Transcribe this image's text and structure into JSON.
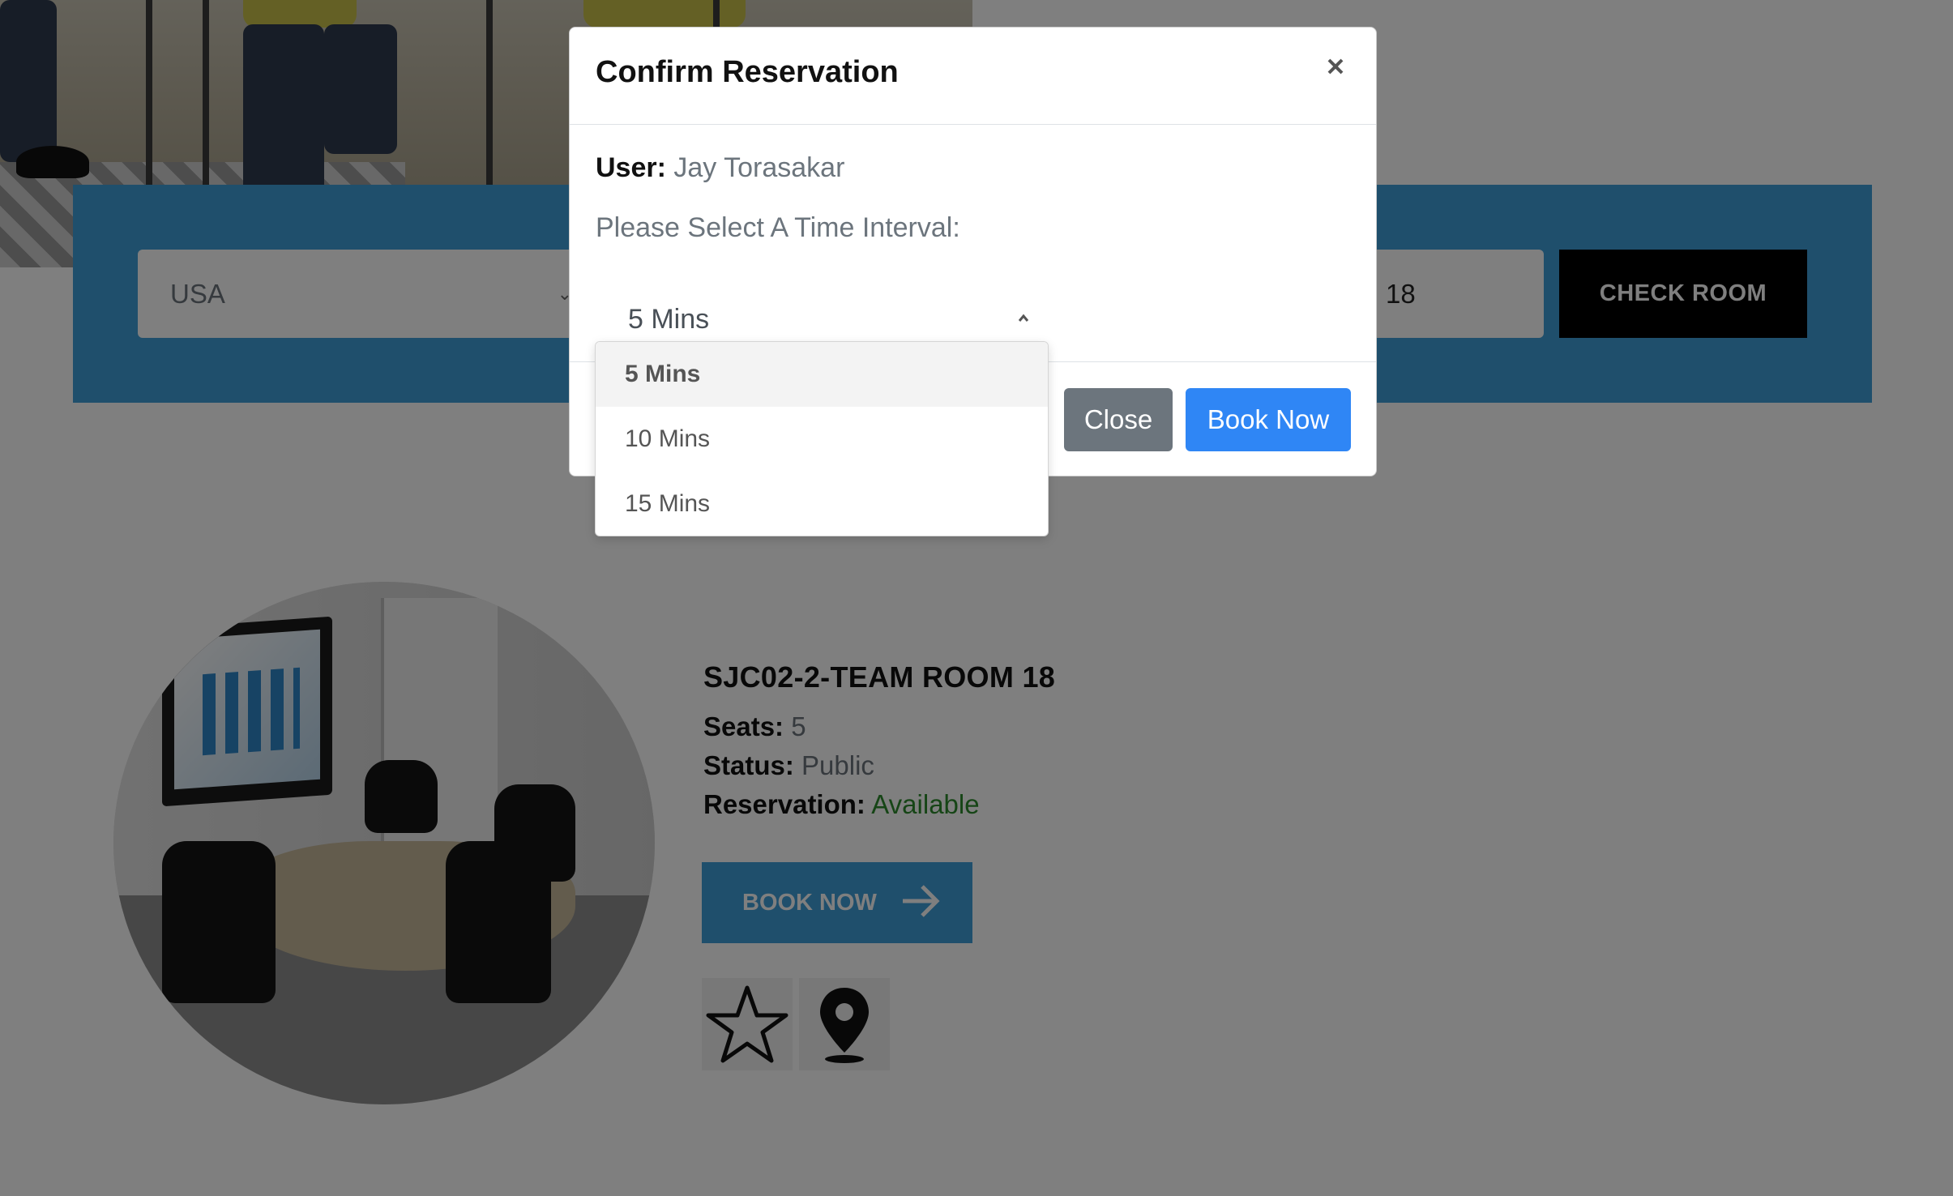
{
  "search": {
    "country_value": "USA",
    "room_value": "18",
    "check_room_label": "CHECK ROOM"
  },
  "room": {
    "title": "SJC02-2-TEAM ROOM 18",
    "seats_label": "Seats:",
    "seats_value": "5",
    "status_label": "Status:",
    "status_value": "Public",
    "reservation_label": "Reservation:",
    "reservation_value": "Available",
    "book_now_label": "BOOK NOW",
    "favorite_icon": "star-icon",
    "location_icon": "map-pin-icon"
  },
  "modal": {
    "title": "Confirm Reservation",
    "close_icon": "close-icon",
    "user_label": "User:",
    "user_value": "Jay Torasakar",
    "interval_prompt": "Please Select A Time Interval:",
    "interval_selected": "5 Mins",
    "interval_options": [
      "5 Mins",
      "10 Mins",
      "15 Mins"
    ],
    "close_button_label": "Close",
    "book_button_label": "Book Now"
  },
  "colors": {
    "band_blue": "#3f9fd8",
    "primary_button": "#2f86f5",
    "secondary_button": "#6c757d",
    "available_green": "#2d8a2d"
  }
}
